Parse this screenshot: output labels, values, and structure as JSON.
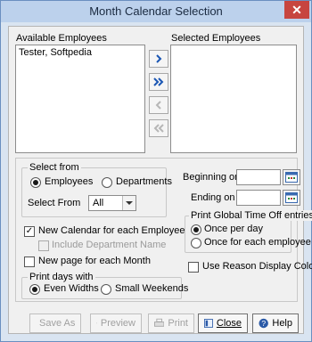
{
  "window": {
    "title": "Month Calendar Selection",
    "close_glyph": "✕"
  },
  "available": {
    "label": "Available Employees",
    "items": [
      "Tester, Softpedia"
    ]
  },
  "selected": {
    "label": "Selected Employees",
    "items": []
  },
  "transfer_buttons": [
    {
      "icon": "chevron-right-icon",
      "enabled": true
    },
    {
      "icon": "double-chevron-right-icon",
      "enabled": true
    },
    {
      "icon": "chevron-left-icon",
      "enabled": false
    },
    {
      "icon": "double-chevron-left-icon",
      "enabled": false
    }
  ],
  "select_from": {
    "title": "Select from",
    "employees_label": "Employees",
    "departments_label": "Departments",
    "selected": "Employees",
    "combo_label": "Select From",
    "combo_value": "All"
  },
  "dates": {
    "beginning_label": "Beginning on",
    "ending_label": "Ending on",
    "beginning_value": "",
    "ending_value": ""
  },
  "options": {
    "new_calendar_label": "New Calendar for each Employee",
    "new_calendar_checked": true,
    "include_department_label": "Include Department Name",
    "include_department_checked": false,
    "new_page_label": "New page for each Month",
    "new_page_checked": false,
    "use_reason_label": "Use Reason Display Colors",
    "use_reason_checked": false
  },
  "print_global": {
    "title": "Print Global Time Off entries",
    "once_per_day_label": "Once per day",
    "once_each_label": "Once for each employee",
    "selected": "Once per day"
  },
  "print_days": {
    "title": "Print days with",
    "even_label": "Even Widths",
    "small_label": "Small Weekends",
    "selected": "Even Widths"
  },
  "buttons": {
    "save_as": "Save As",
    "preview": "Preview",
    "print": "Print",
    "close": "Close",
    "help": "Help"
  },
  "colors": {
    "accent": "#1a56b4",
    "title_bar": "#bcd1ec",
    "close": "#c7453f"
  }
}
